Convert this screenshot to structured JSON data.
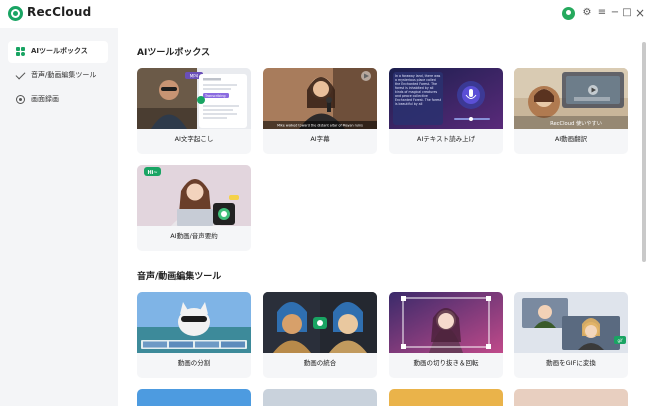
{
  "app": {
    "title": "RecCloud"
  },
  "window_controls": {
    "settings": "⚙",
    "menu": "≡",
    "minimize": "−",
    "maximize": "□",
    "close": "×"
  },
  "sidebar": {
    "items": [
      {
        "label": "AIツールボックス"
      },
      {
        "label": "音声/動画編集ツール"
      },
      {
        "label": "画面録画"
      }
    ]
  },
  "sections": [
    {
      "title": "AIツールボックス",
      "cards": [
        {
          "label": "AI文字起こし"
        },
        {
          "label": "AI字幕"
        },
        {
          "label": "AIテキスト読み上げ"
        },
        {
          "label": "AI動画翻訳"
        },
        {
          "label": "AI動画/音声要約"
        }
      ]
    },
    {
      "title": "音声/動画編集ツール",
      "cards": [
        {
          "label": "動画の分割"
        },
        {
          "label": "動画の統合"
        },
        {
          "label": "動画の切り抜き＆回転"
        },
        {
          "label": "動画をGIFに変換"
        }
      ]
    }
  ],
  "thumb_text": {
    "mp4": "MP4",
    "transcribing": "Transcribing",
    "subtitle": "Mike walked toward the distant altar of Mayan ruins",
    "tts_text": "In a faraway land, there was a mysterious place called the Enchanted Forest. The forest is inhabited by all kinds of magical creatures and peace collective Enchanted Forest. The forest is beautiful by all",
    "translate_caption": "RecCloud 使いやすい",
    "hi": "Hi~",
    "gif": "gif"
  },
  "colors": {
    "accent": "#19a463",
    "sidebar_bg": "#f4f5f7",
    "card_bg": "#f5f6f8"
  }
}
